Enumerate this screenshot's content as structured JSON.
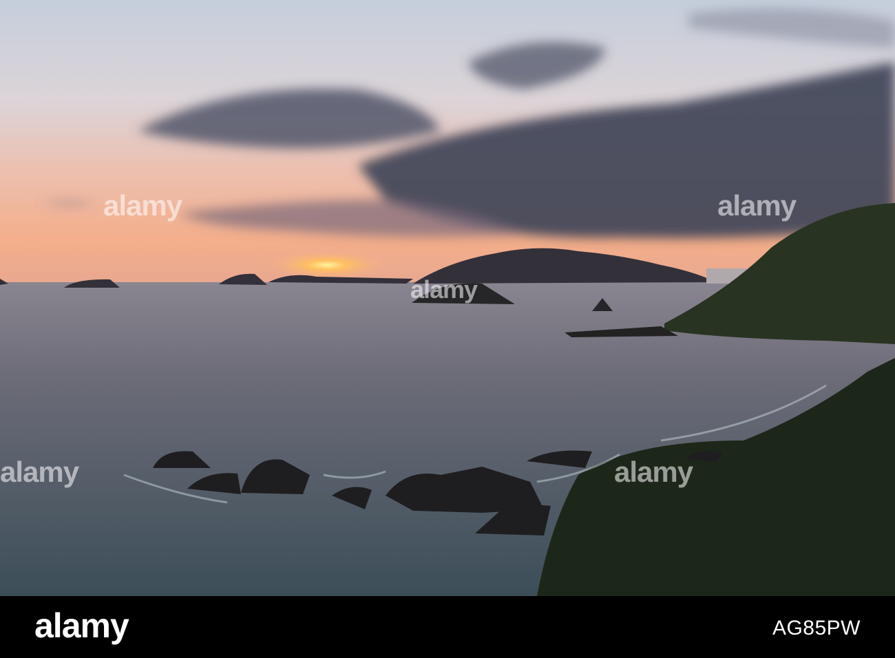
{
  "watermark": {
    "brand": "alamy"
  },
  "footer": {
    "logo": "alamy",
    "image_id": "AG85PW"
  },
  "colors": {
    "sky_top": "#c7cfdc",
    "horizon": "#f2b08c",
    "sea": "#5e6270",
    "land": "#1e2a1c",
    "cloud": "#3e4457"
  }
}
